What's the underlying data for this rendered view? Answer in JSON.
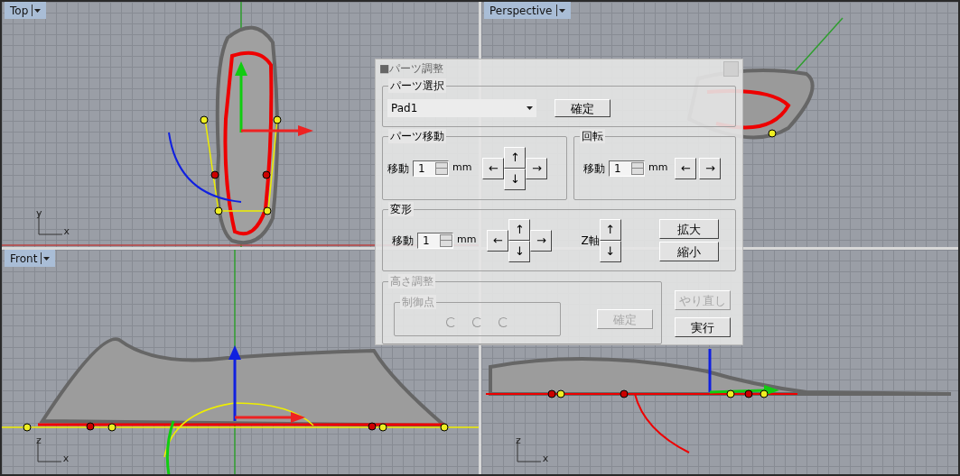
{
  "viewports": [
    {
      "label": "Top",
      "axes": [
        "y",
        "x"
      ],
      "kind": "top"
    },
    {
      "label": "Perspective",
      "kind": "perspective"
    },
    {
      "label": "Front",
      "axes": [
        "z",
        "x"
      ],
      "kind": "front"
    },
    {
      "axes": [
        "z",
        "x"
      ],
      "kind": "right"
    }
  ],
  "dialog": {
    "title": "■パーツ調整",
    "parts_select": {
      "title": "パーツ選択",
      "dropdown": {
        "value": "Pad1"
      },
      "confirm": {
        "label": "確定",
        "disabled": false
      }
    },
    "parts_move": {
      "title": "パーツ移動",
      "spin": {
        "label": "移動",
        "value": "1",
        "unit": "mm"
      },
      "arrows": {
        "left": "←",
        "up": "↑",
        "right": "→",
        "down": "↓"
      }
    },
    "rotate": {
      "title": "回転",
      "spin": {
        "label": "移動",
        "value": "1",
        "unit": "mm"
      },
      "left": "←",
      "right": "→"
    },
    "deform": {
      "title": "変形",
      "spin": {
        "label": "移動",
        "value": "1",
        "unit": "mm"
      },
      "arrows": {
        "left": "←",
        "up": "↑",
        "right": "→",
        "down": "↓"
      },
      "z_axis": {
        "label": "Z軸",
        "up": "↑",
        "down": "↓"
      },
      "enlarge": "拡大",
      "shrink": "縮小"
    },
    "height_adjust": {
      "title": "高さ調整",
      "disabled": true,
      "control_points": {
        "title": "制御点",
        "radios": [
          {
            "selected": false
          },
          {
            "selected": false
          },
          {
            "selected": false
          }
        ]
      },
      "confirm": {
        "label": "確定",
        "disabled": true
      }
    },
    "redo": {
      "label": "やり直し",
      "disabled": true
    },
    "run": {
      "label": "実行",
      "disabled": false
    }
  }
}
